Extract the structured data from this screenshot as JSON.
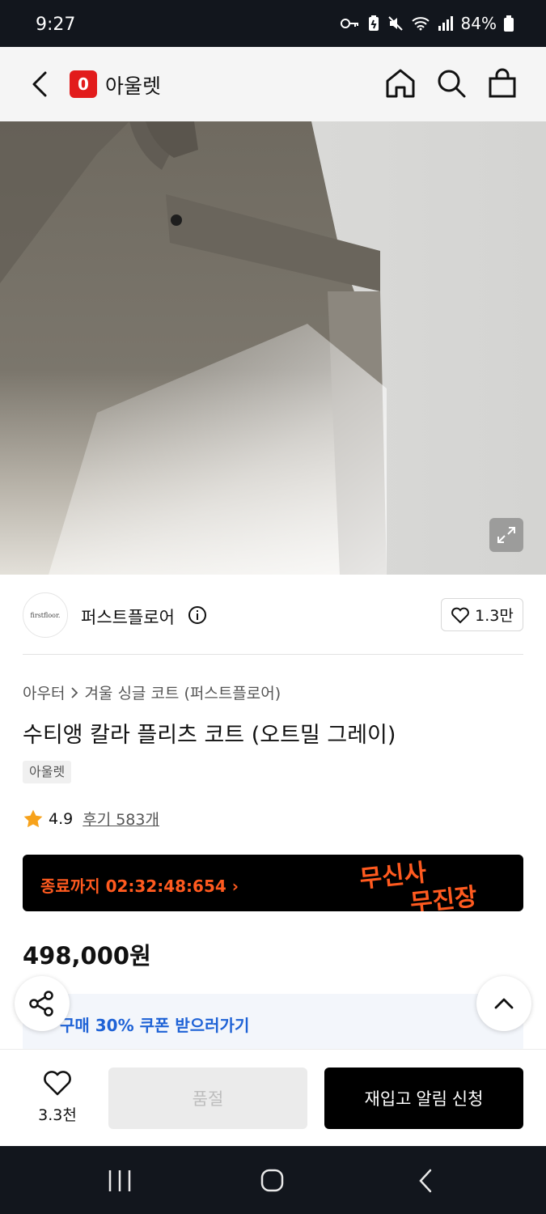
{
  "status_bar": {
    "time": "9:27",
    "battery": "84%",
    "icons": [
      "key-icon",
      "battery-saver-icon",
      "mute-icon",
      "wifi-icon",
      "signal-icon",
      "battery-icon"
    ]
  },
  "header": {
    "logo_letter": "0",
    "title": "아울렛",
    "icons": [
      "back-icon",
      "home-icon",
      "search-icon",
      "bag-icon"
    ],
    "logo_color": "#e21c1c"
  },
  "hero": {
    "image_subject": "oatmeal grey wool coat with belt",
    "expand_icon": "expand-icon"
  },
  "brand": {
    "logo_text": "firstfloor.",
    "name": "퍼스트플로어",
    "likes": "1.3만"
  },
  "breadcrumb": {
    "category": "아우터",
    "subcategory": "겨울 싱글 코트 (퍼스트플로어)"
  },
  "product": {
    "title": "수티앵 칼라 플리츠 코트 (오트밀 그레이)",
    "tag": "아울렛",
    "rating": "4.9",
    "reviews": "후기 583개",
    "price": "498,000원"
  },
  "timer_banner": {
    "text": "종료까지 02:32:48:654",
    "brand_line1": "무신사",
    "brand_line2": "무진장",
    "accent": "#ff5a1f"
  },
  "coupon": {
    "text": "구매 30% 쿠폰 받으러가기",
    "color": "#1e62d6"
  },
  "action_bar": {
    "wish_count": "3.3천",
    "soldout_label": "품절",
    "restock_label": "재입고 알림 신청"
  },
  "nav_bar": {
    "icons": [
      "recents-icon",
      "home-circle-icon",
      "back-nav-icon"
    ]
  }
}
